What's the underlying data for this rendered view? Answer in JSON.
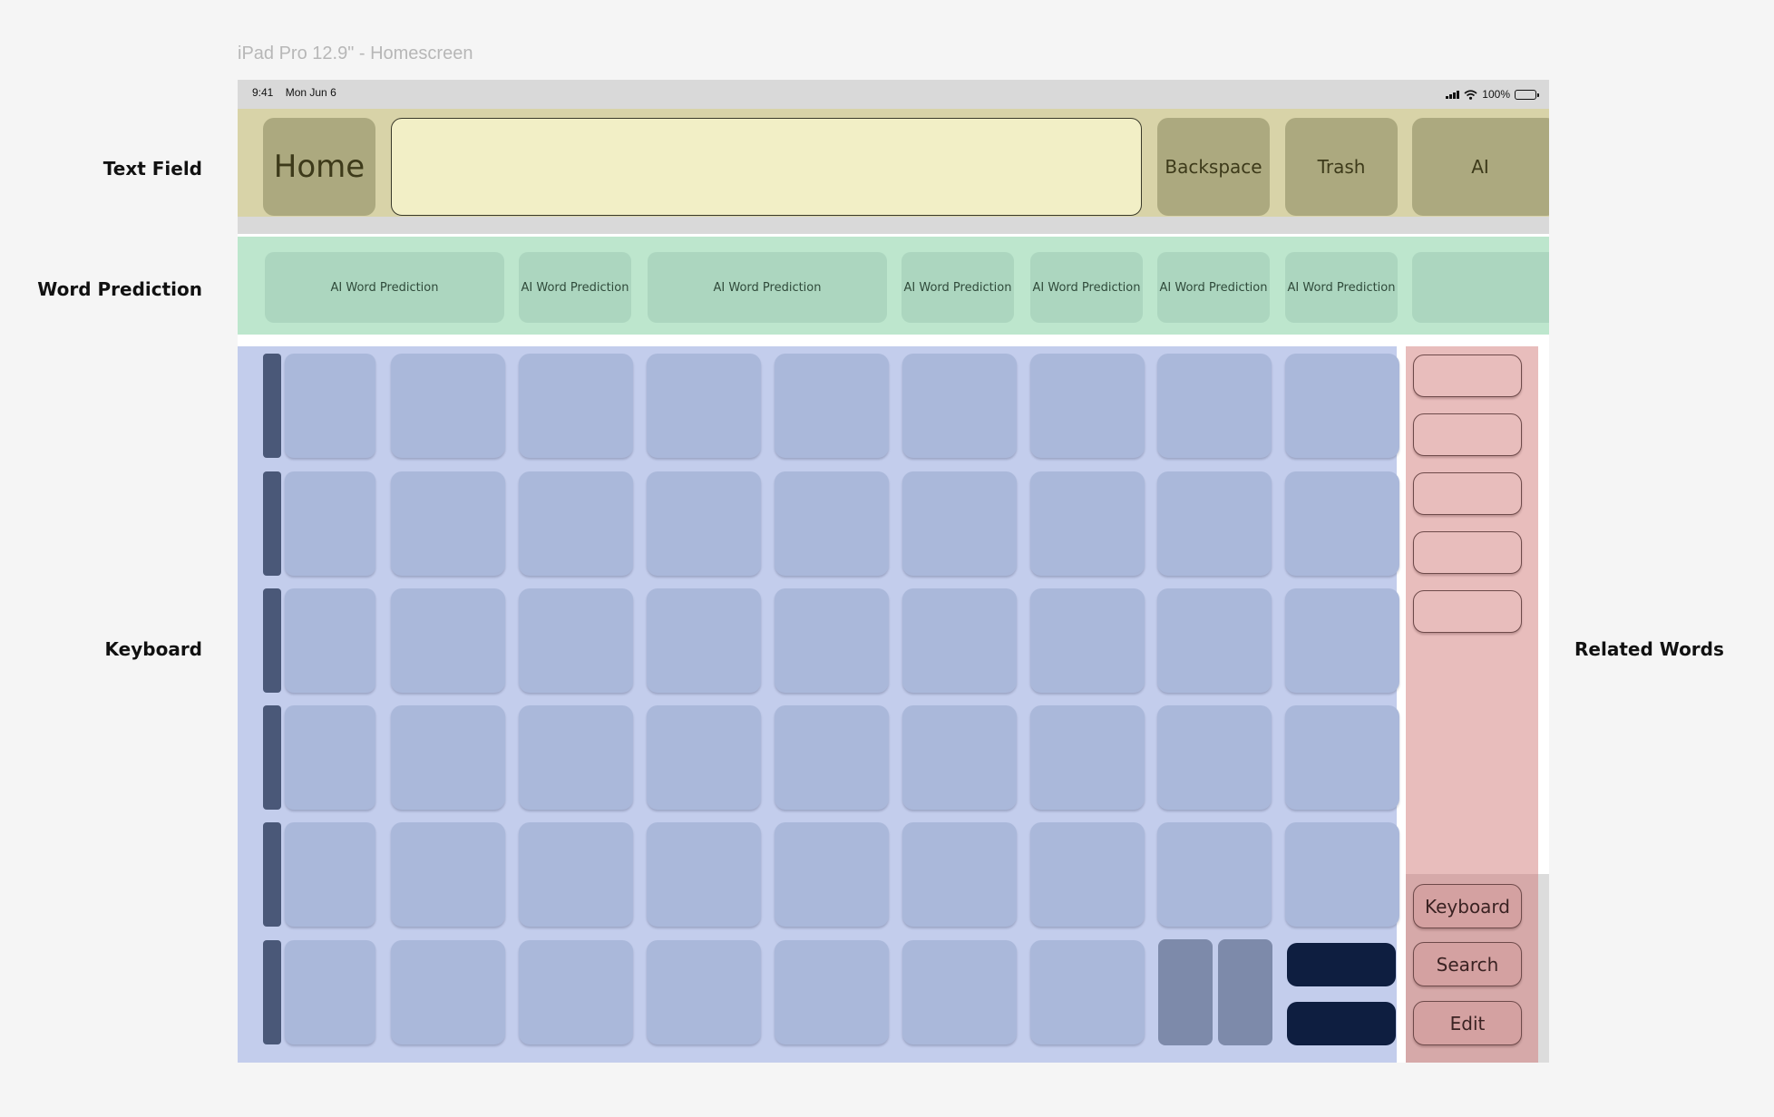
{
  "frame_title": "iPad Pro 12.9\" - Homescreen",
  "side_labels": {
    "text_field": "Text Field",
    "word_prediction": "Word Prediction",
    "keyboard": "Keyboard",
    "related_words": "Related Words"
  },
  "status_bar": {
    "time": "9:41",
    "date": "Mon Jun 6",
    "battery": "100%",
    "icons": [
      "signal-icon",
      "wifi-icon",
      "battery-icon"
    ]
  },
  "top_bar": {
    "home_label": "Home",
    "text_value": "",
    "backspace_label": "Backspace",
    "trash_label": "Trash",
    "ai_label": "AI"
  },
  "predictions": [
    "AI Word Prediction",
    "AI Word Prediction",
    "AI Word Prediction",
    "AI Word Prediction",
    "AI Word Prediction",
    "AI Word Prediction",
    "AI Word Prediction",
    ""
  ],
  "actions": {
    "keyboard_label": "Keyboard",
    "search_label": "Search",
    "edit_label": "Edit"
  },
  "colors": {
    "text_field_strip": "#d8d3a8",
    "word_prediction_strip": "#bde6cd",
    "keyboard_area": "#c3cdec",
    "related_words_panel": "#e8bdbc",
    "key": "#aab8da",
    "navy_key": "#0e1e40"
  }
}
